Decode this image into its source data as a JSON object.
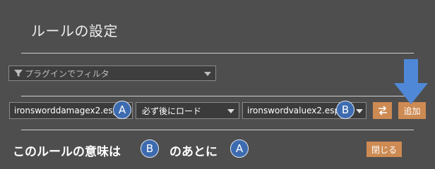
{
  "dialog": {
    "title": "ルールの設定"
  },
  "filter": {
    "placeholder": "プラグインでフィルタ"
  },
  "rule": {
    "first_plugin": "ironsworddamagex2.esp",
    "condition": "必ず後にロード",
    "second_plugin": "ironswordvaluex2.esp",
    "swap_icon": "swap-arrows-icon",
    "add_label": "追加"
  },
  "annotations": {
    "badge_a": "A",
    "badge_b": "B",
    "meaning_prefix": "このルールの意味は",
    "meaning_middle": "のあとに",
    "arrow_color": "#4f88d6"
  },
  "footer": {
    "close_label": "閉じる"
  },
  "colors": {
    "background": "#4e4e4e",
    "button": "#cd8a53",
    "badge": "#3d6bb0"
  }
}
